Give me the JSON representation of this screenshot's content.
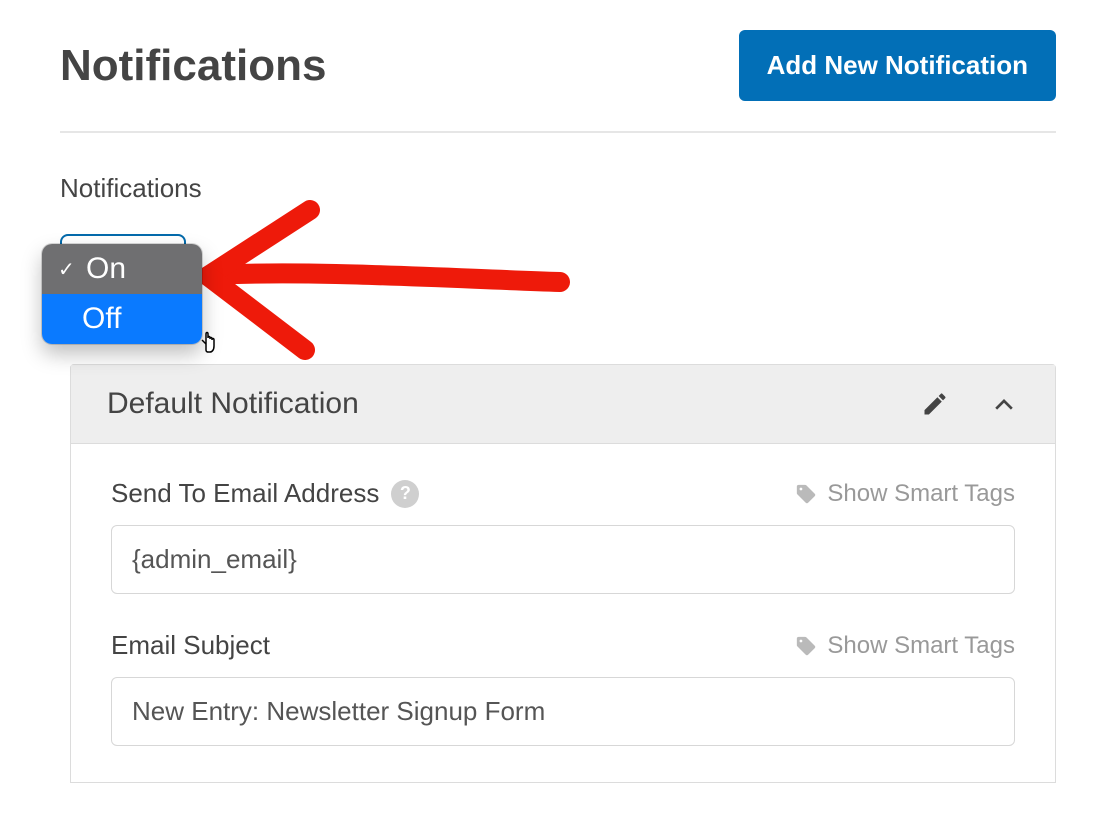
{
  "header": {
    "title": "Notifications",
    "add_button": "Add New Notification"
  },
  "section": {
    "label": "Notifications"
  },
  "toggle": {
    "options": {
      "on": "On",
      "off": "Off"
    },
    "selected": "On",
    "hovered": "Off"
  },
  "panel": {
    "title": "Default Notification",
    "fields": {
      "send_to": {
        "label": "Send To Email Address",
        "value": "{admin_email}",
        "smart_tags_label": "Show Smart Tags"
      },
      "subject": {
        "label": "Email Subject",
        "value": "New Entry: Newsletter Signup Form",
        "smart_tags_label": "Show Smart Tags"
      }
    }
  },
  "icons": {
    "edit": "pencil-icon",
    "collapse": "chevron-up-icon",
    "tag": "tag-icon",
    "help": "?"
  }
}
